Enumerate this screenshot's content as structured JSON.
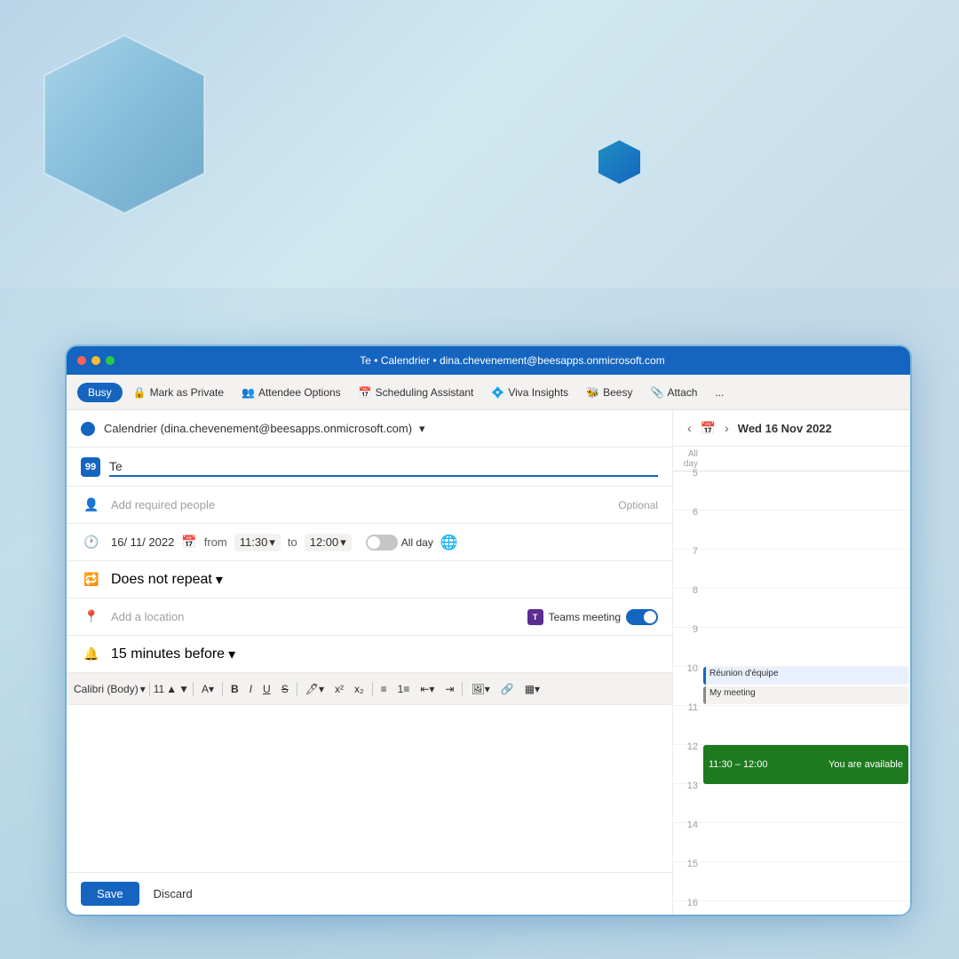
{
  "window": {
    "title": "Te • Calendrier • dina.chevenement@beesapps.onmicrosoft.com",
    "controls": {
      "close": "close",
      "minimize": "minimize",
      "maximize": "maximize"
    }
  },
  "toolbar": {
    "busy_label": "Busy",
    "mark_private_label": "Mark as Private",
    "attendee_options_label": "Attendee Options",
    "scheduling_assistant_label": "Scheduling Assistant",
    "viva_insights_label": "Viva Insights",
    "beesy_label": "Beesy",
    "attach_label": "Attach",
    "more_label": "..."
  },
  "form": {
    "calendar_value": "Calendrier (dina.chevenement@beesapps.onmicrosoft.com)",
    "title_value": "Te",
    "title_placeholder": "",
    "people_placeholder": "Add required people",
    "optional_label": "Optional",
    "date_value": "16/ 11/ 2022",
    "from_time": "11:30",
    "to_time": "12:00",
    "all_day_label": "All day",
    "repeat_value": "Does not repeat",
    "location_placeholder": "Add a location",
    "teams_meeting_label": "Teams meeting",
    "reminder_value": "15 minutes before"
  },
  "format_toolbar": {
    "font_name": "Calibri (Body)",
    "font_size": "11",
    "bold": "B",
    "italic": "I",
    "underline": "U",
    "strikethrough": "S"
  },
  "footer": {
    "save_label": "Save",
    "discard_label": "Discard"
  },
  "calendar_sidebar": {
    "date_label": "Wed 16 Nov 2022",
    "all_day_label": "All day",
    "hours": [
      "5",
      "6",
      "7",
      "8",
      "9",
      "10",
      "11",
      "12",
      "13",
      "14",
      "15",
      "16"
    ],
    "events": [
      {
        "name": "Réunion d'équipe",
        "hour_row": 10,
        "type": "reunion"
      },
      {
        "name": "My meeting",
        "hour_row": 10,
        "type": "my"
      },
      {
        "name": "11:30 – 12:00",
        "right_label": "You are available",
        "hour_row": 12,
        "type": "new"
      }
    ]
  }
}
